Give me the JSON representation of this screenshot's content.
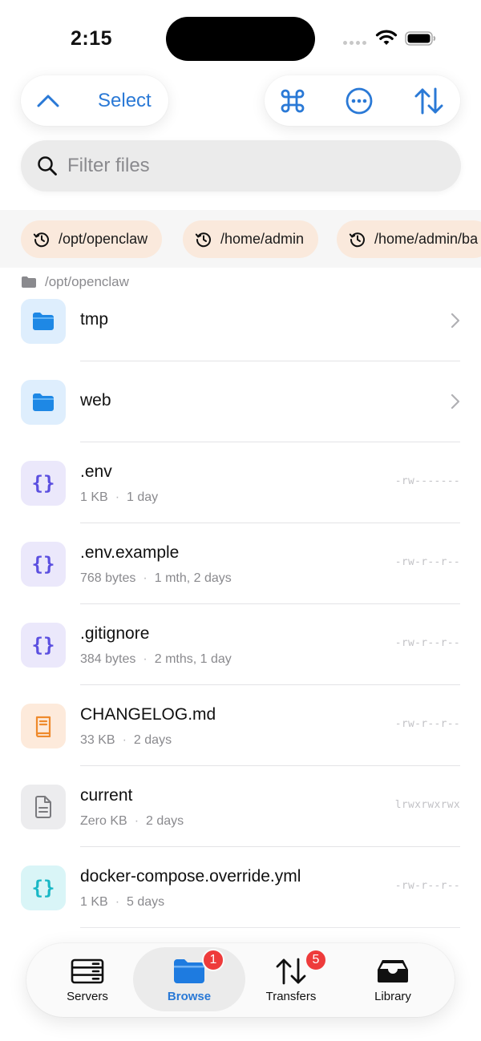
{
  "status_bar": {
    "time": "2:15"
  },
  "toolbar": {
    "select_label": "Select",
    "icons": [
      "chevron-up-icon",
      "command-icon",
      "more-icon",
      "sort-icon"
    ],
    "accent_color": "#2a79d6"
  },
  "search": {
    "placeholder": "Filter files",
    "value": ""
  },
  "recent_paths": [
    {
      "label": "/opt/openclaw"
    },
    {
      "label": "/home/admin"
    },
    {
      "label": "/home/admin/ba"
    }
  ],
  "current_folder": {
    "path": "/opt/openclaw"
  },
  "files": [
    {
      "name": "tmp",
      "type": "folder",
      "size": "",
      "modified": "",
      "permissions": ""
    },
    {
      "name": "web",
      "type": "folder",
      "size": "",
      "modified": "",
      "permissions": ""
    },
    {
      "name": ".env",
      "type": "config",
      "size": "1 KB",
      "modified": "1 day",
      "permissions": "-rw-------"
    },
    {
      "name": ".env.example",
      "type": "config",
      "size": "768 bytes",
      "modified": "1 mth, 2 days",
      "permissions": "-rw-r--r--"
    },
    {
      "name": ".gitignore",
      "type": "config",
      "size": "384 bytes",
      "modified": "2 mths, 1 day",
      "permissions": "-rw-r--r--"
    },
    {
      "name": "CHANGELOG.md",
      "type": "markdown",
      "size": "33 KB",
      "modified": "2 days",
      "permissions": "-rw-r--r--"
    },
    {
      "name": "current",
      "type": "document",
      "size": "Zero KB",
      "modified": "2 days",
      "permissions": "lrwxrwxrwx"
    },
    {
      "name": "docker-compose.override.yml",
      "type": "yaml",
      "size": "1 KB",
      "modified": "5 days",
      "permissions": "-rw-r--r--"
    }
  ],
  "tabbar": {
    "tabs": [
      {
        "label": "Servers",
        "icon": "server-icon",
        "badge": ""
      },
      {
        "label": "Browse",
        "icon": "folder-icon",
        "badge": "1",
        "active": true
      },
      {
        "label": "Transfers",
        "icon": "transfer-icon",
        "badge": "5"
      },
      {
        "label": "Library",
        "icon": "tray-icon",
        "badge": ""
      }
    ],
    "badge_color": "#ee3b3b"
  }
}
